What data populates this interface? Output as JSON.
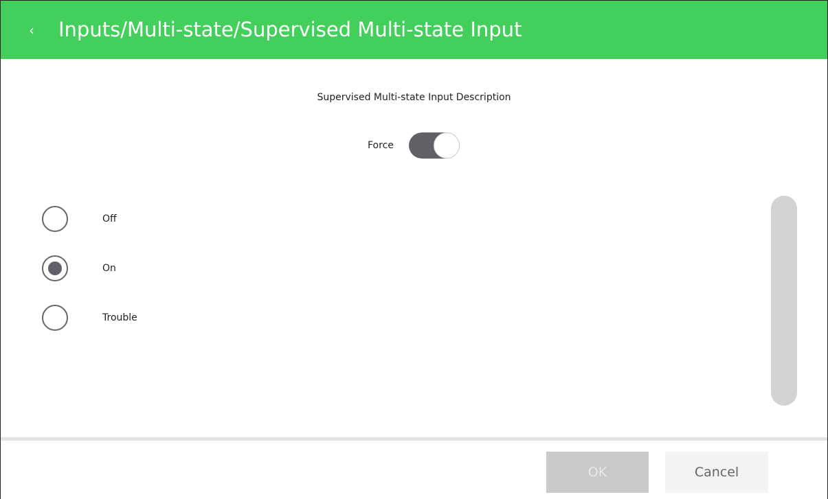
{
  "header": {
    "back_glyph": "‹",
    "title": "Inputs/Multi-state/Supervised Multi-state Input",
    "background_color": "#43cf5c"
  },
  "content": {
    "description": "Supervised Multi-state Input Description",
    "force": {
      "label": "Force",
      "enabled": true
    },
    "options": [
      {
        "label": "Off",
        "selected": false
      },
      {
        "label": "On",
        "selected": true
      },
      {
        "label": "Trouble",
        "selected": false
      }
    ]
  },
  "footer": {
    "ok_label": "OK",
    "cancel_label": "Cancel"
  }
}
